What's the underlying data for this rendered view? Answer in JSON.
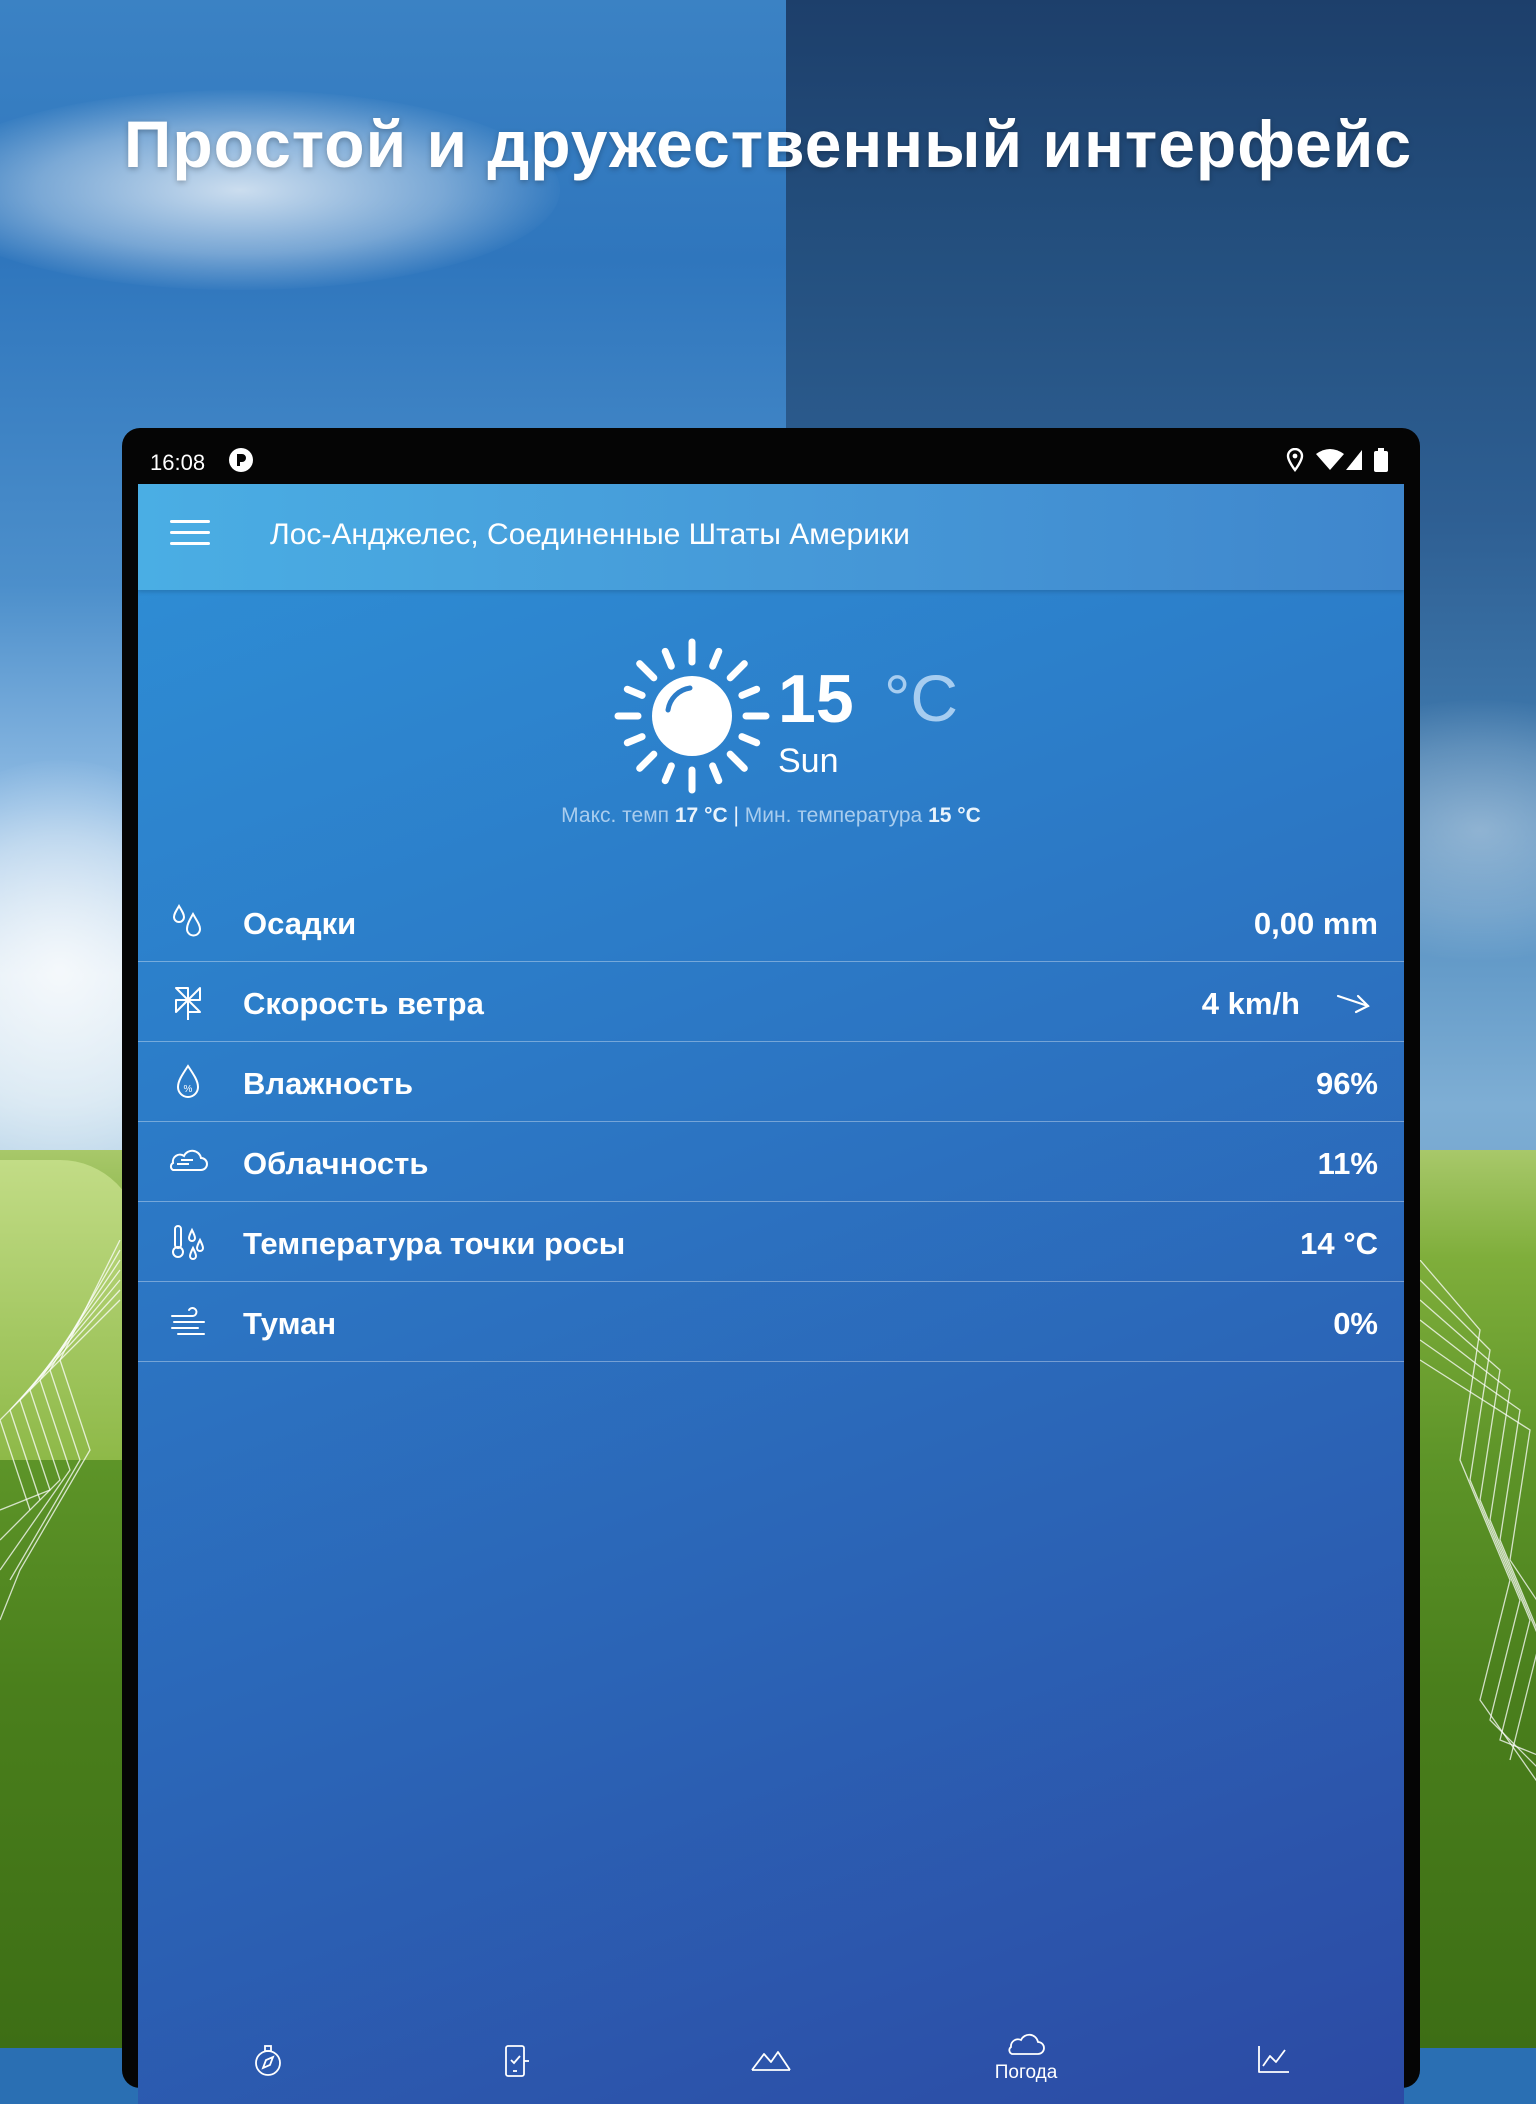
{
  "headline": "Простой и дружественный интерфейс",
  "statusbar": {
    "time": "16:08"
  },
  "toolbar": {
    "location": "Лос-Анджелес, Соединенные Штаты Америки"
  },
  "current": {
    "temperature": "15",
    "unit": "°C",
    "condition": "Sun",
    "max_label": "Макс. темп",
    "max_value": "17 °C",
    "separator": "|",
    "min_label": "Мин. температура",
    "min_value": "15 °C"
  },
  "details": [
    {
      "label": "Осадки",
      "value": "0,00 mm",
      "icon": "raindrops-icon"
    },
    {
      "label": "Скорость ветра",
      "value": "4 km/h",
      "icon": "pinwheel-icon"
    },
    {
      "label": "Влажность",
      "value": "96%",
      "icon": "humidity-drop-icon"
    },
    {
      "label": "Облачность",
      "value": "11%",
      "icon": "cloud-icon"
    },
    {
      "label": "Температура точки росы",
      "value": "14 °C",
      "icon": "dewpoint-icon"
    },
    {
      "label": "Туман",
      "value": "0%",
      "icon": "fog-icon"
    }
  ],
  "bottom_nav": {
    "items": [
      {
        "icon": "compass-icon",
        "label": ""
      },
      {
        "icon": "phone-icon",
        "label": ""
      },
      {
        "icon": "mountain-icon",
        "label": ""
      },
      {
        "icon": "cloud-nav-icon",
        "label": "Погода"
      },
      {
        "icon": "chart-icon",
        "label": ""
      }
    ]
  },
  "colors": {
    "screen_top": "#2e8fd6",
    "screen_bottom": "#2c4aa4",
    "toolbar": "#4596d6",
    "unit_accent": "#a7cdf0"
  }
}
